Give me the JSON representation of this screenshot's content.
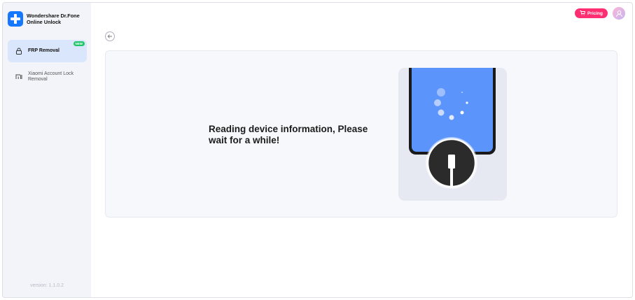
{
  "app": {
    "title": "Wondershare Dr.Fone Online Unlock",
    "version": "version: 1.1.0.2"
  },
  "sidebar": {
    "items": [
      {
        "label": "FRP Removal",
        "badge": "NEW",
        "active": true,
        "icon": "lock-icon"
      },
      {
        "label": "Xiaomi Account Lock Removal",
        "active": false,
        "icon": "mi-logo-icon"
      }
    ]
  },
  "header": {
    "pricing_label": "Pricing"
  },
  "main": {
    "status_message": "Reading device information, Please wait for a while!"
  },
  "colors": {
    "accent": "#1677ff",
    "pricing": "#ff2e73",
    "badge_new": "#1fc66a",
    "phone_screen": "#5b94fb"
  }
}
